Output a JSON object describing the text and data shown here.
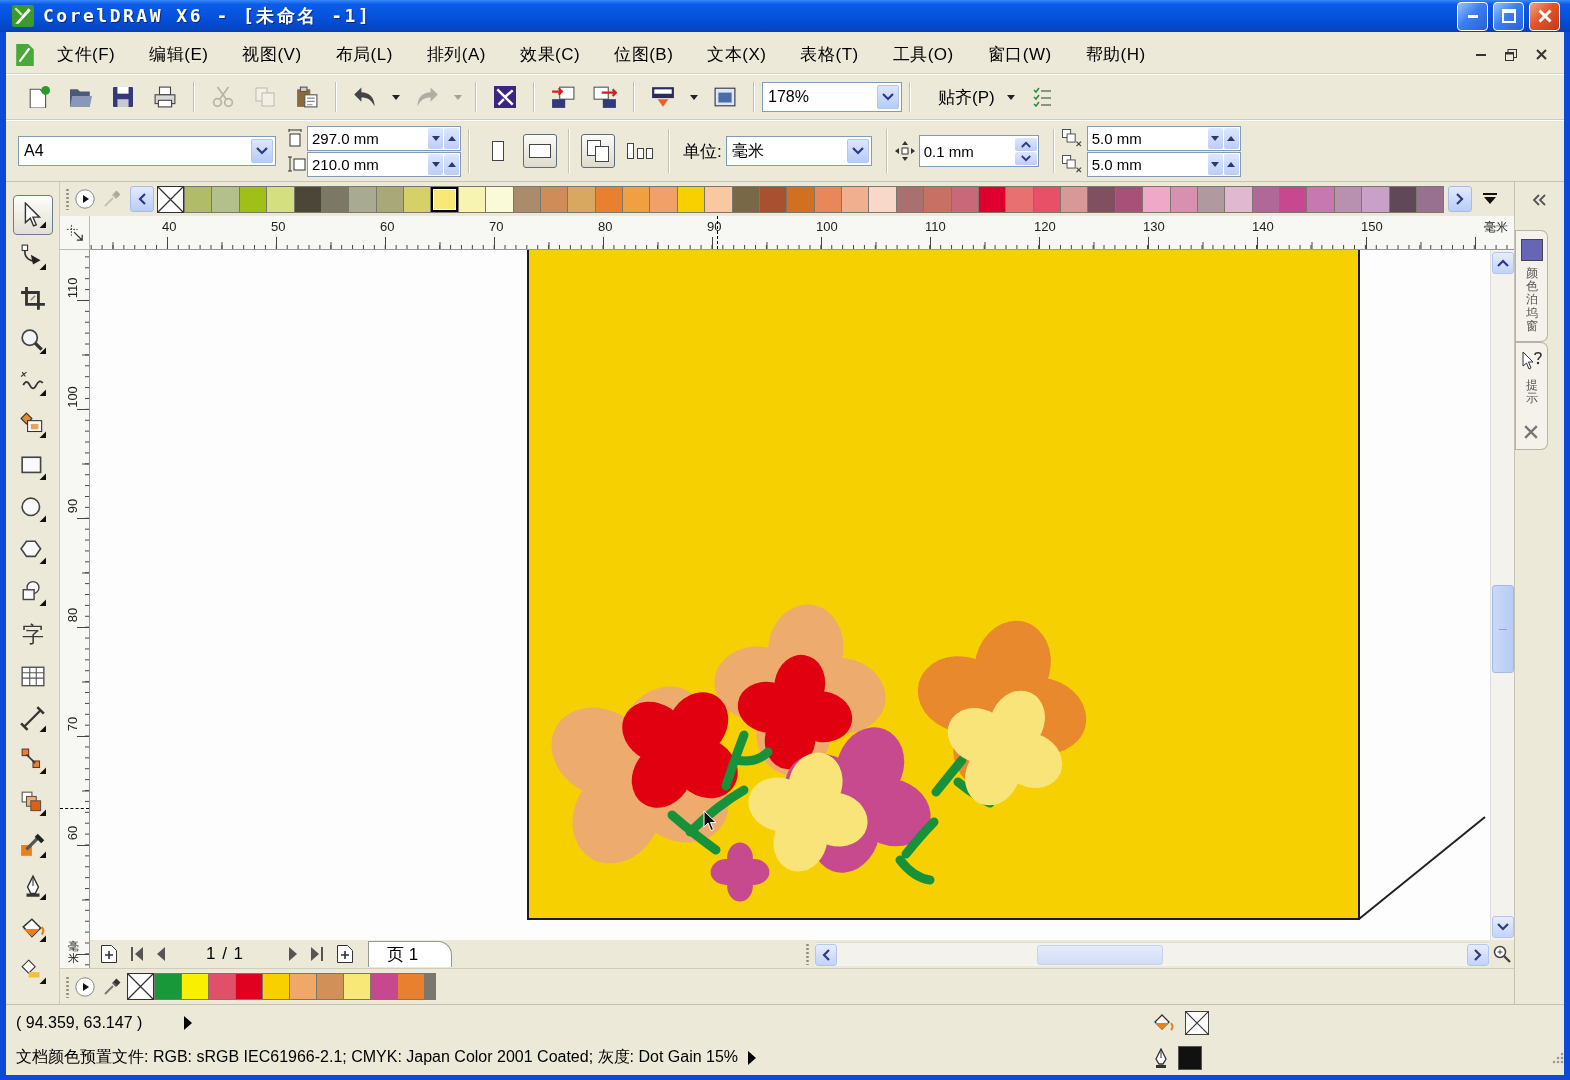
{
  "window": {
    "title": "CorelDRAW X6 - [未命名 -1]"
  },
  "menu": [
    "文件(F)",
    "编辑(E)",
    "视图(V)",
    "布局(L)",
    "排列(A)",
    "效果(C)",
    "位图(B)",
    "文本(X)",
    "表格(T)",
    "工具(O)",
    "窗口(W)",
    "帮助(H)"
  ],
  "toolbar": {
    "groups": [
      {
        "buttons": [
          {
            "kind": "new",
            "disabled": false
          },
          {
            "kind": "open",
            "disabled": false
          },
          {
            "kind": "save",
            "disabled": false
          },
          {
            "kind": "print",
            "disabled": false
          }
        ]
      },
      {
        "buttons": [
          {
            "kind": "cut",
            "disabled": true
          },
          {
            "kind": "copy",
            "disabled": true
          },
          {
            "kind": "paste",
            "disabled": false
          }
        ]
      },
      {
        "buttons": [
          {
            "kind": "undo",
            "disabled": false
          },
          {
            "kind": "arrow",
            "disabled": false
          },
          {
            "kind": "redo",
            "disabled": true
          },
          {
            "kind": "arrow",
            "disabled": true
          }
        ]
      },
      {
        "buttons": [
          {
            "kind": "search",
            "disabled": false
          }
        ]
      },
      {
        "buttons": [
          {
            "kind": "import",
            "disabled": false
          },
          {
            "kind": "export",
            "disabled": false
          }
        ]
      },
      {
        "buttons": [
          {
            "kind": "launcher",
            "disabled": false
          },
          {
            "kind": "arrow",
            "disabled": false
          },
          {
            "kind": "welcome",
            "disabled": false
          }
        ]
      }
    ],
    "zoom": "178%",
    "snap": "贴齐(P)",
    "end_buttons": [
      {
        "kind": "arrow",
        "disabled": false
      },
      {
        "kind": "options",
        "disabled": false
      }
    ]
  },
  "property_bar": {
    "paper": "A4",
    "width": "297.0 mm",
    "height": "210.0 mm",
    "orientation": [
      {
        "kind": "portrait",
        "selected": false
      },
      {
        "kind": "landscape",
        "selected": true
      }
    ],
    "page_scope": [
      {
        "kind": "all",
        "selected": true
      },
      {
        "kind": "current",
        "selected": false
      }
    ],
    "unit_label": "单位:",
    "unit": "毫米",
    "nudge": "0.1 mm",
    "duplicate_x": "5.0 mm",
    "duplicate_y": "5.0 mm"
  },
  "palette": {
    "swatches": [
      {
        "color": "#b0bc68",
        "selected": false
      },
      {
        "color": "#b4c08c",
        "selected": false
      },
      {
        "color": "#a0c018",
        "selected": false
      },
      {
        "color": "#d4e080",
        "selected": false
      },
      {
        "color": "#4c4638",
        "selected": false
      },
      {
        "color": "#7c7866",
        "selected": false
      },
      {
        "color": "#a8aa92",
        "selected": false
      },
      {
        "color": "#a8a878",
        "selected": false
      },
      {
        "color": "#d6d068",
        "selected": false
      },
      {
        "color": "#f8e878",
        "selected": true
      },
      {
        "color": "#f6f4b0",
        "selected": false
      },
      {
        "color": "#fafad8",
        "selected": false
      },
      {
        "color": "#a88c6c",
        "selected": false
      },
      {
        "color": "#d08c58",
        "selected": false
      },
      {
        "color": "#d8a860",
        "selected": false
      },
      {
        "color": "#e88030",
        "selected": false
      },
      {
        "color": "#f0a040",
        "selected": false
      },
      {
        "color": "#f0a068",
        "selected": false
      },
      {
        "color": "#f8d000",
        "selected": false
      },
      {
        "color": "#f8c8a0",
        "selected": false
      },
      {
        "color": "#786848",
        "selected": false
      },
      {
        "color": "#a85030",
        "selected": false
      },
      {
        "color": "#d07020",
        "selected": false
      },
      {
        "color": "#e88858",
        "selected": false
      },
      {
        "color": "#f0b090",
        "selected": false
      },
      {
        "color": "#f8d8c8",
        "selected": false
      },
      {
        "color": "#a87070",
        "selected": false
      },
      {
        "color": "#c87064",
        "selected": false
      },
      {
        "color": "#c86878",
        "selected": false
      },
      {
        "color": "#e00030",
        "selected": false
      },
      {
        "color": "#e87070",
        "selected": false
      },
      {
        "color": "#e85068",
        "selected": false
      },
      {
        "color": "#d89898",
        "selected": false
      },
      {
        "color": "#805060",
        "selected": false
      },
      {
        "color": "#a85078",
        "selected": false
      },
      {
        "color": "#f0a8c8",
        "selected": false
      },
      {
        "color": "#d890b0",
        "selected": false
      },
      {
        "color": "#b09aa0",
        "selected": false
      },
      {
        "color": "#e0b8d0",
        "selected": false
      },
      {
        "color": "#b06898",
        "selected": false
      },
      {
        "color": "#c84890",
        "selected": false
      },
      {
        "color": "#c878b0",
        "selected": false
      },
      {
        "color": "#b890b0",
        "selected": false
      },
      {
        "color": "#c8a0c8",
        "selected": false
      },
      {
        "color": "#604858",
        "selected": false
      },
      {
        "color": "#987090",
        "selected": false
      }
    ]
  },
  "toolbox": {
    "tools": [
      {
        "kind": "pick",
        "selected": true
      },
      {
        "kind": "shape",
        "selected": false
      },
      {
        "kind": "crop",
        "selected": false
      },
      {
        "kind": "zoom",
        "selected": false
      },
      {
        "kind": "freehand",
        "selected": false
      },
      {
        "kind": "smart-fill",
        "selected": false
      },
      {
        "kind": "rectangle",
        "selected": false
      },
      {
        "kind": "ellipse",
        "selected": false
      },
      {
        "kind": "polygon",
        "selected": false
      },
      {
        "kind": "basic-shapes",
        "selected": false
      },
      {
        "kind": "text",
        "label": "字",
        "selected": false
      },
      {
        "kind": "table",
        "selected": false
      },
      {
        "kind": "dimension",
        "selected": false
      },
      {
        "kind": "connector",
        "selected": false
      },
      {
        "kind": "blend",
        "selected": false
      },
      {
        "kind": "eyedropper",
        "selected": false
      },
      {
        "kind": "outline",
        "selected": false
      },
      {
        "kind": "fill",
        "selected": false
      },
      {
        "kind": "interactive-fill",
        "selected": false
      }
    ]
  },
  "rulers": {
    "horizontal": {
      "labels": [
        "40",
        "50",
        "60",
        "70",
        "80",
        "90",
        "100",
        "110",
        "120",
        "130",
        "140",
        "150"
      ],
      "unit": "毫米"
    },
    "vertical": {
      "labels": [
        "110",
        "100",
        "90",
        "80",
        "70",
        "60"
      ],
      "unit": "毫米"
    }
  },
  "navigator": {
    "pages": "1 / 1",
    "tabs": [
      {
        "label": "页 1",
        "selected": true
      }
    ]
  },
  "document_palette": {
    "swatches": [
      {
        "color": "#189838"
      },
      {
        "color": "#f8f000"
      },
      {
        "color": "#e05068"
      },
      {
        "color": "#e00020"
      },
      {
        "color": "#f8d000"
      },
      {
        "color": "#f0a868"
      },
      {
        "color": "#d09058"
      },
      {
        "color": "#f8e878"
      },
      {
        "color": "#c84890"
      },
      {
        "color": "#e88030"
      }
    ]
  },
  "docker": {
    "tabs": [
      {
        "kind": "color",
        "label": "颜色泊坞窗"
      },
      {
        "kind": "hints",
        "label": "提示"
      }
    ]
  },
  "status_bar": {
    "coordinates": "( 94.359, 63.147 )",
    "color_profile": "文档颜色预置文件: RGB: sRGB IEC61966-2.1; CMYK: Japan Color 2001 Coated; 灰度: Dot Gain 15%"
  }
}
